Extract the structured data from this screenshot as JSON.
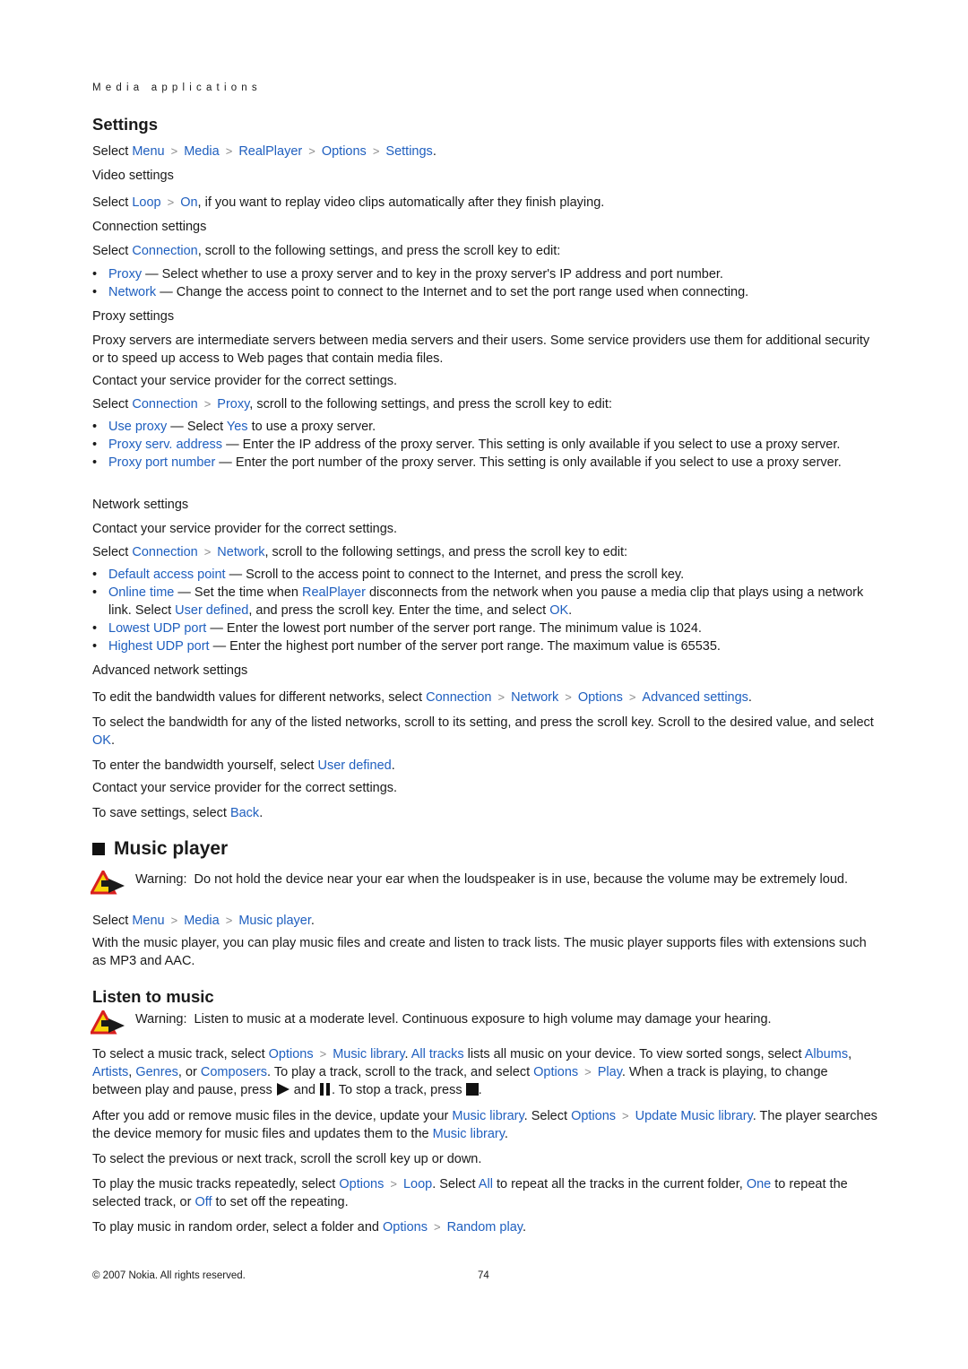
{
  "header": {
    "running_title": "Media applications"
  },
  "settings": {
    "title": "Settings",
    "path": {
      "prefix": "Select ",
      "items": [
        "Menu",
        "Media",
        "RealPlayer",
        "Options",
        "Settings"
      ],
      "suffix": "."
    },
    "video": {
      "title": "Video settings",
      "prefix": "Select ",
      "items": [
        "Loop",
        "On"
      ],
      "suffix": ", if you want to replay video clips automatically after they finish playing."
    },
    "connection": {
      "title": "Connection settings",
      "intro_prefix": "Select ",
      "intro_link": "Connection",
      "intro_suffix": ", scroll to the following settings, and press the scroll key to edit:",
      "bullets": [
        {
          "term": "Proxy",
          "text": " — Select whether to use a proxy server and to key in the proxy server's IP address and port number."
        },
        {
          "term": "Network",
          "text": " — Change the access point to connect to the Internet and to set the port range used when connecting."
        }
      ]
    },
    "proxy": {
      "title": "Proxy settings",
      "p1": "Proxy servers are intermediate servers between media servers and their users. Some service providers use them for additional security or to speed up access to Web pages that contain media files.",
      "p2": "Contact your service provider for the correct settings.",
      "path_prefix": "Select ",
      "path_items": [
        "Connection",
        "Proxy"
      ],
      "path_suffix": ", scroll to the following settings, and press the scroll key to edit:",
      "bullets": [
        {
          "term": "Use proxy",
          "text": " — Select ",
          "link2": "Yes",
          "text2": " to use a proxy server."
        },
        {
          "term": "Proxy serv. address",
          "text": " — Enter the IP address of the proxy server. This setting is only available if you select to use a proxy server."
        },
        {
          "term": "Proxy port number",
          "text": " — Enter the port number of the proxy server. This setting is only available if you select to use a proxy server."
        }
      ]
    },
    "network": {
      "title": "Network settings",
      "p1": "Contact your service provider for the correct settings.",
      "path_prefix": "Select ",
      "path_items": [
        "Connection",
        "Network"
      ],
      "path_suffix": ", scroll to the following settings, and press the scroll key to edit:",
      "bullets": [
        {
          "term": "Default access point",
          "text": " — Scroll to the access point to connect to the Internet, and press the scroll key."
        },
        {
          "term": "Online time",
          "text": " — Set the time when ",
          "link2": "RealPlayer",
          "text2": " disconnects from the network when you pause a media clip that plays using a network link. Select ",
          "link3": "User defined",
          "text3": ", and press the scroll key. Enter the time, and select ",
          "link4": "OK",
          "text4": "."
        },
        {
          "term": "Lowest UDP port",
          "text": " — Enter the lowest port number of the server port range. The minimum value is 1024."
        },
        {
          "term": "Highest UDP port",
          "text": " — Enter the highest port number of the server port range. The maximum value is 65535."
        }
      ]
    },
    "advanced": {
      "title": "Advanced network settings",
      "p1_prefix": "To edit the bandwidth values for different networks, select ",
      "p1_items": [
        "Connection",
        "Network",
        "Options",
        "Advanced settings"
      ],
      "p1_suffix": ".",
      "p2_a": "To select the bandwidth for any of the listed networks, scroll to its setting, and press the scroll key. Scroll to the desired value, and select ",
      "p2_link": "OK",
      "p2_b": ".",
      "p3_a": "To enter the bandwidth yourself, select ",
      "p3_link": "User defined",
      "p3_b": ".",
      "p4": "Contact your service provider for the correct settings.",
      "p5_a": "To save settings, select ",
      "p5_link": "Back",
      "p5_b": "."
    }
  },
  "music_player": {
    "title": "Music player",
    "warning_label": "Warning:",
    "warning_text": "  Do not hold the device near your ear when the loudspeaker is in use, because the volume may be extremely loud.",
    "path_prefix": "Select ",
    "path_items": [
      "Menu",
      "Media",
      "Music player"
    ],
    "path_suffix": ".",
    "intro": "With the music player, you can play music files and create and listen to track lists. The music player supports files with extensions such as MP3 and AAC."
  },
  "listen": {
    "title": "Listen to music",
    "warning_label": "Warning:",
    "warning_text": "  Listen to music at a moderate level. Continuous exposure to high volume may damage your hearing.",
    "p1": {
      "a": "To select a music track, select ",
      "l1": "Options",
      "l2": "Music library",
      "b": ". ",
      "l3": "All tracks",
      "c": " lists all music on your device. To view sorted songs, select ",
      "l4": "Albums",
      "d": ", ",
      "l5": "Artists",
      "e": ", ",
      "l6": "Genres",
      "f": ", or ",
      "l7": "Composers",
      "g": ". To play a track, scroll to the track, and select ",
      "l8": "Options",
      "l9": "Play",
      "h": ". When a track is playing, to change between play and pause, press ",
      "i": " and ",
      "j": ". To stop a track, press ",
      "k": "."
    },
    "p2": {
      "a": "After you add or remove music files in the device, update your ",
      "l1": "Music library",
      "b": ". Select ",
      "l2": "Options",
      "l3": "Update Music library",
      "c": ". The player searches the device memory for music files and updates them to the ",
      "l4": "Music library",
      "d": "."
    },
    "p3": "To select the previous or next track, scroll the scroll key up or down.",
    "p4": {
      "a": "To play the music tracks repeatedly, select ",
      "l1": "Options",
      "l2": "Loop",
      "b": ". Select ",
      "l3": "All",
      "c": " to repeat all the tracks in the current folder, ",
      "l4": "One",
      "d": " to repeat the selected track, or ",
      "l5": "Off",
      "e": " to set off the repeating."
    },
    "p5": {
      "a": "To play music in random order, select a folder and ",
      "l1": "Options",
      "l2": "Random play",
      "b": "."
    }
  },
  "footer": {
    "copyright": "© 2007 Nokia. All rights reserved.",
    "page_number": "74"
  },
  "icons": {
    "chevron": "chevron-right-icon",
    "warning": "warning-icon",
    "play": "play-icon",
    "pause": "pause-icon",
    "stop": "stop-icon"
  }
}
